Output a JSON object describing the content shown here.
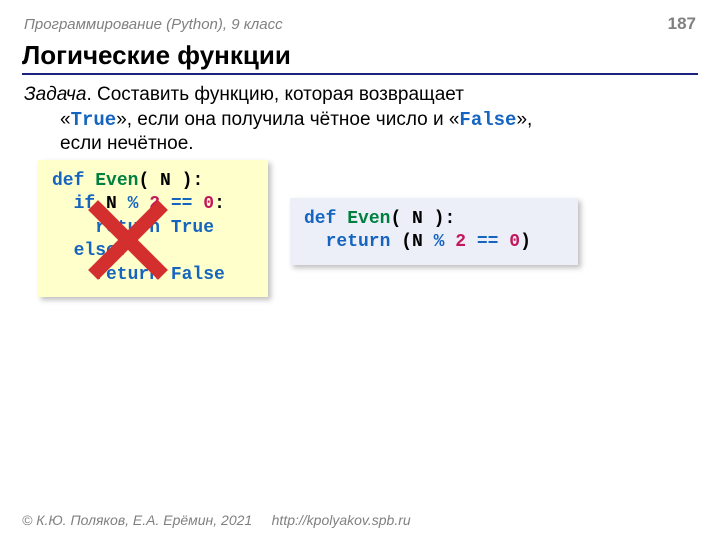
{
  "header": {
    "course": "Программирование (Python), 9 класс",
    "page": "187"
  },
  "title": "Логические функции",
  "task": {
    "label": "Задача",
    "line_rest": ". Составить функцию, которая возвращает",
    "line2_a": "«",
    "true_lit": "True",
    "line2_b": "», если она получила чётное число и «",
    "false_lit": "False",
    "line2_c": "»,",
    "line3": "если нечётное."
  },
  "code_long": {
    "l1_def": "def ",
    "l1_fn": "Even",
    "l1_rest": "( N ):",
    "l2_if": "  if ",
    "l2_n": "N",
    "l2_pct": " % ",
    "l2_two": "2",
    "l2_eq": " == ",
    "l2_zero": "0",
    "l2_colon": ":",
    "l3_ret": "    return ",
    "l3_true": "True",
    "l4_else": "  else",
    "l4_colon": ":",
    "l5_ret": "    return ",
    "l5_false": "False"
  },
  "code_short": {
    "l1_def": "def ",
    "l1_fn": "Even",
    "l1_rest": "( N ):",
    "l2_ret": "  return ",
    "l2_open": "(N",
    "l2_pct": " % ",
    "l2_two": "2",
    "l2_eq": " == ",
    "l2_zero": "0",
    "l2_close": ")"
  },
  "footer": {
    "copyright": "© К.Ю. Поляков, Е.А. Ерёмин, 2021",
    "url": "http://kpolyakov.spb.ru"
  }
}
